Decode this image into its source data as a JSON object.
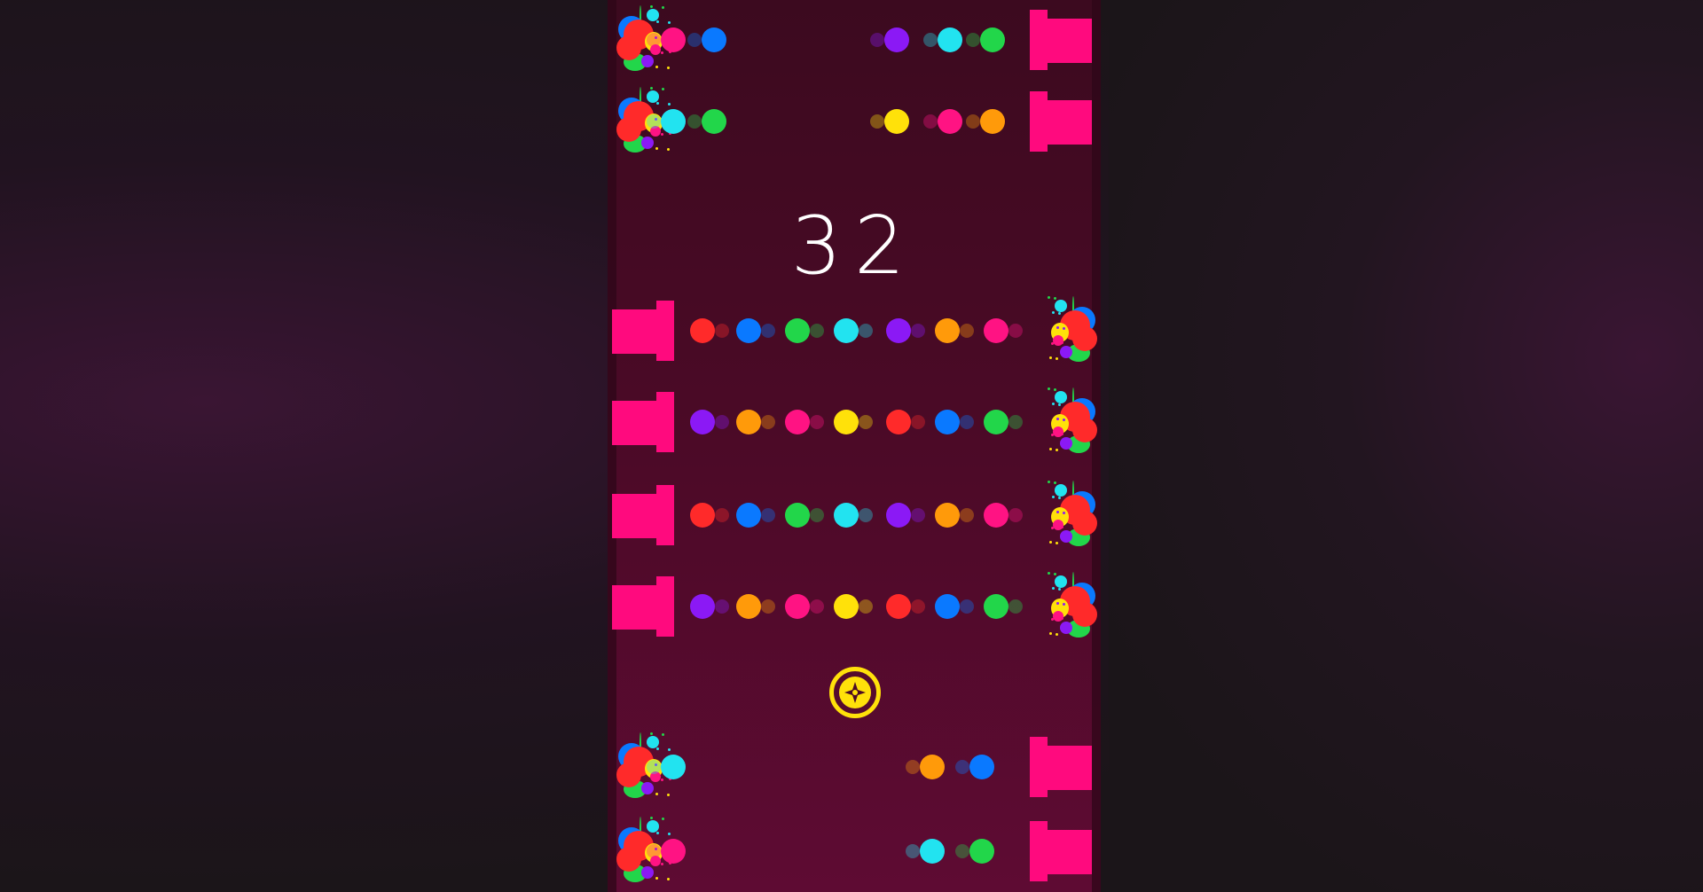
{
  "score": "32",
  "colors": {
    "magenta": "#ff0a7e",
    "pink": "#ff1383",
    "red": "#ff2a2a",
    "blue": "#0a79ff",
    "green": "#22d64a",
    "cyan": "#22e3f0",
    "purple": "#8b19f5",
    "orange": "#ff9a0a",
    "yellow": "#ffe10a"
  },
  "rows_top": [
    {
      "cannon_side": "right",
      "left_dots": [
        "pink",
        "blue"
      ],
      "right_dots": [
        "purple",
        "cyan",
        "green"
      ]
    },
    {
      "cannon_side": "right",
      "left_dots": [
        "cyan",
        "green"
      ],
      "right_dots": [
        "yellow",
        "pink",
        "orange"
      ]
    }
  ],
  "rows_middle": [
    {
      "cannon_side": "left",
      "dots": [
        "red",
        "blue",
        "green",
        "cyan",
        "purple",
        "orange",
        "pink"
      ]
    },
    {
      "cannon_side": "left",
      "dots": [
        "purple",
        "orange",
        "pink",
        "yellow",
        "red",
        "blue",
        "green"
      ]
    },
    {
      "cannon_side": "left",
      "dots": [
        "red",
        "blue",
        "green",
        "cyan",
        "purple",
        "orange",
        "pink"
      ]
    },
    {
      "cannon_side": "left",
      "dots": [
        "purple",
        "orange",
        "pink",
        "yellow",
        "red",
        "blue",
        "green"
      ]
    }
  ],
  "rows_bottom": [
    {
      "cannon_side": "right",
      "left_dots": [
        "cyan"
      ],
      "right_dots": [
        "orange",
        "blue"
      ]
    },
    {
      "cannon_side": "right",
      "left_dots": [
        "pink"
      ],
      "right_dots": [
        "cyan",
        "green"
      ]
    }
  ],
  "player": {
    "icon": "star-compass-icon",
    "color": "#ffe10a"
  }
}
